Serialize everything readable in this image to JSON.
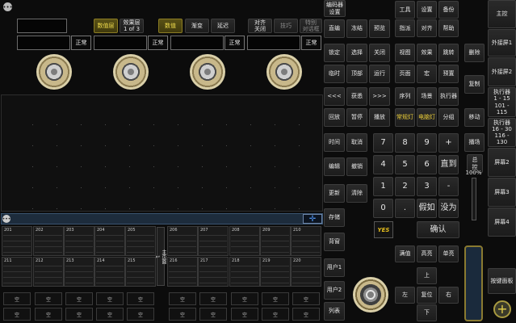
{
  "top_controls": {
    "values_layer": "数值层",
    "effects_layer": "效果层\n1 of 3",
    "tabs": [
      "数值",
      "渐变",
      "延迟"
    ],
    "align_off": "对齐\n关闭",
    "tricks": "技巧",
    "special_dialog": "特别\n对话框"
  },
  "faders": [
    {
      "state": "正常"
    },
    {
      "state": "正常"
    },
    {
      "state": "正常"
    },
    {
      "state": "正常"
    }
  ],
  "view": {
    "grid_top": [
      "201",
      "202",
      "203",
      "204",
      "205",
      "206",
      "207",
      "208",
      "209",
      "210"
    ],
    "grid_bottom": [
      "211",
      "212",
      "213",
      "214",
      "215",
      "216",
      "217",
      "218",
      "219",
      "220"
    ],
    "page_label": "主页面\n1",
    "slot_label": "空"
  },
  "keys": {
    "encoder_settings": "编码器\n设置",
    "row_a": [
      "直编",
      "冻结",
      "预览"
    ],
    "row_b": [
      "锁定",
      "选择",
      "关闭"
    ],
    "row_c": [
      "临时",
      "顶部",
      "运行"
    ],
    "row_d": [
      "<<<",
      "获悉",
      ">>>"
    ],
    "row_e": [
      "回放",
      "暂停",
      "播放"
    ],
    "side": [
      "时间",
      "编辑",
      "更新",
      "存储",
      "背窗",
      "用户1",
      "用户2",
      "列表"
    ],
    "side_b": [
      "取消",
      "撤销",
      "清除"
    ],
    "tools": [
      "工具",
      "设置",
      "备份"
    ],
    "tools2": [
      "指派",
      "对齐",
      "帮助"
    ],
    "view_row": [
      "视图",
      "效果",
      "跳转"
    ],
    "page_row": [
      "页面",
      "宏",
      "预置"
    ],
    "seq_row": [
      "序列",
      "场景",
      "执行器"
    ],
    "light_row": [
      "常规灯",
      "电脑灯",
      "分组"
    ],
    "numpad": [
      "7",
      "8",
      "9",
      "+",
      "4",
      "5",
      "6",
      "直到",
      "1",
      "2",
      "3",
      "-",
      "0",
      ".",
      "假如",
      "没为"
    ],
    "confirm": "确认",
    "delete": "删除",
    "copy": "复制",
    "move": "移动",
    "field": "播场",
    "total": "总\n控",
    "percent": "100%",
    "full": "满值",
    "highlight": "高亮",
    "solo": "单亮",
    "up": "上",
    "left": "左",
    "reset": "复位",
    "right": "右",
    "down": "下",
    "logo": "YES"
  },
  "right_menu": {
    "main": "主控",
    "ext1": "外接屏1",
    "ext2": "外接屏2",
    "exec1": "执行器\n1 - 15\n101 - 115",
    "exec2": "执行器\n16 - 30\n116 - 130",
    "screen2": "屏幕2",
    "screen3": "屏幕3",
    "screen4": "屏幕4",
    "keypad": "按键面板"
  }
}
